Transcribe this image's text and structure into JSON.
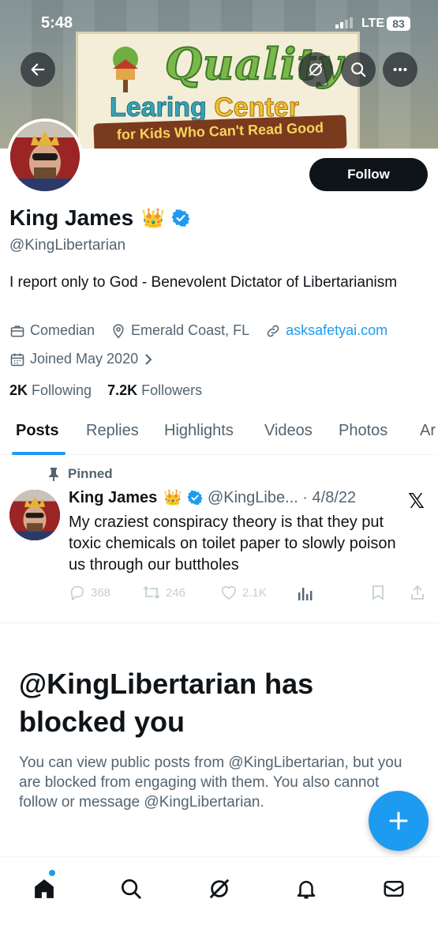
{
  "status_bar": {
    "time": "5:48",
    "network": "LTE",
    "battery": "83"
  },
  "banner": {
    "sign_line1": "Quality",
    "sign_line2a": "Learing ",
    "sign_line2b": "Center",
    "sign_line3": "for Kids Who Can't Read Good"
  },
  "profile": {
    "follow_label": "Follow",
    "name": "King James",
    "crown": "👑",
    "handle": "@KingLibertarian",
    "bio": "I report only to God - Benevolent Dictator of Libertarianism",
    "category": "Comedian",
    "location": "Emerald Coast, FL",
    "website": "asksafetyai.com",
    "joined": "Joined May 2020",
    "following_count": "2K",
    "following_label": "Following",
    "followers_count": "7.2K",
    "followers_label": "Followers"
  },
  "tabs": [
    "Posts",
    "Replies",
    "Highlights",
    "Videos",
    "Photos",
    "Ar"
  ],
  "pinned_post": {
    "pinned_label": "Pinned",
    "author": "King James",
    "crown": "👑",
    "handle_date": "@KingLibe... · 4/8/22",
    "x_mark": "𝕏",
    "text": "My craziest conspiracy theory is that they put toxic chemicals on toilet paper to slowly poison us through our buttholes",
    "replies": "368",
    "reposts": "246",
    "likes": "2.1K"
  },
  "blocked": {
    "title": "@KingLibertarian has blocked you",
    "text": "You can view public posts from @KingLibertarian, but you are blocked from engaging with them. You also cannot follow or message @KingLibertarian."
  },
  "colors": {
    "accent": "#1d9bf0",
    "text": "#0f1419",
    "muted": "#536471"
  },
  "nav_icons": [
    "home-icon",
    "search-icon",
    "grok-icon",
    "notifications-icon",
    "messages-icon"
  ]
}
